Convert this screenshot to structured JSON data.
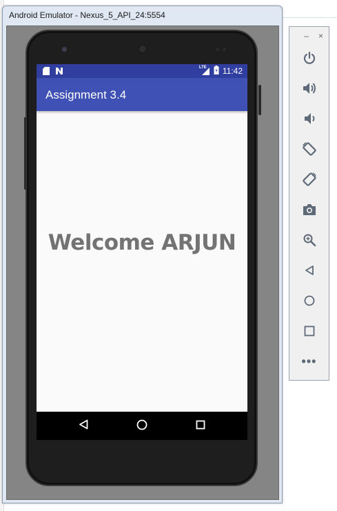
{
  "window": {
    "title": "Android Emulator - Nexus_5_API_24:5554"
  },
  "status_bar": {
    "network_label": "LTE",
    "time": "11:42"
  },
  "app": {
    "title": "Assignment 3.4",
    "welcome_text": "Welcome ARJUN"
  },
  "nav_bar": {
    "buttons": [
      "back-icon",
      "home-icon",
      "recents-icon"
    ]
  },
  "toolbar": {
    "minimize": "–",
    "close": "×",
    "buttons": [
      "power-icon",
      "volume-up-icon",
      "volume-down-icon",
      "rotate-left-icon",
      "rotate-right-icon",
      "camera-icon",
      "zoom-icon",
      "back-icon",
      "home-icon",
      "overview-icon",
      "more-icon"
    ],
    "more_label": "•••"
  },
  "colors": {
    "status_bar": "#303f9f",
    "app_bar": "#3f51b5",
    "welcome_text": "#737373",
    "toolbar_icon": "#5f6a78"
  }
}
